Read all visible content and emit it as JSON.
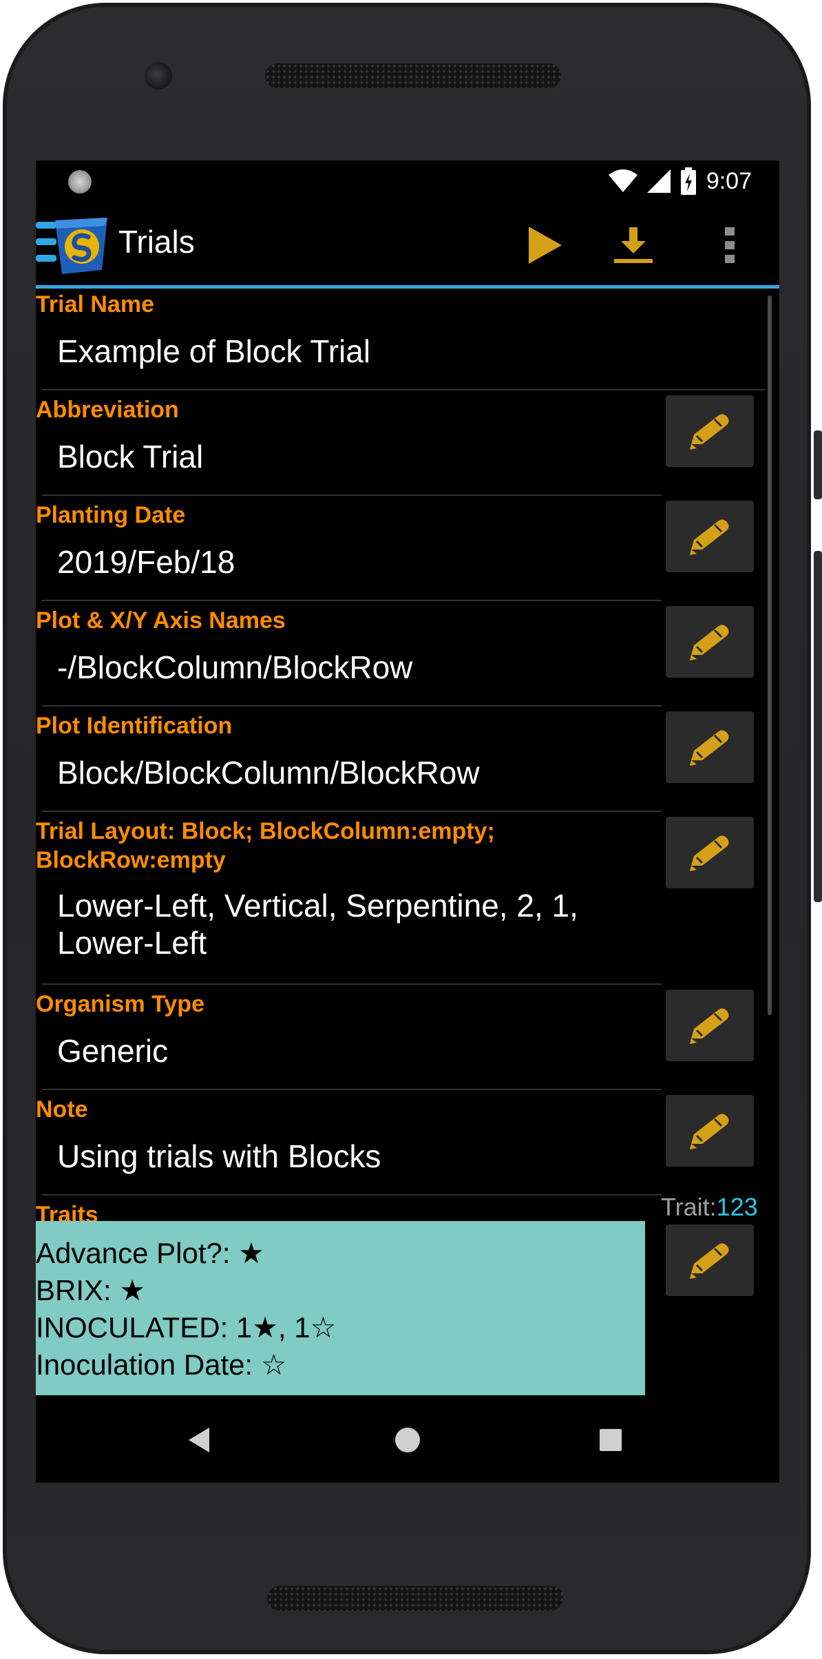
{
  "statusbar": {
    "time": "9:07"
  },
  "appbar": {
    "title": "Trials"
  },
  "fields": [
    {
      "label": "Trial Name",
      "value": "Example of Block Trial"
    },
    {
      "label": "Abbreviation",
      "value": "Block Trial"
    },
    {
      "label": "Planting Date",
      "value": "2019/Feb/18"
    },
    {
      "label": "Plot & X/Y Axis Names",
      "value": "-/BlockColumn/BlockRow"
    },
    {
      "label": "Plot Identification",
      "value": "Block/BlockColumn/BlockRow"
    },
    {
      "label_line1": "Trial Layout: Block; BlockColumn:empty;",
      "label_line2": "BlockRow:empty",
      "value_line1": "Lower-Left, Vertical, Serpentine, 2, 1,",
      "value_line2": "Lower-Left"
    },
    {
      "label": "Organism Type",
      "value": "Generic"
    },
    {
      "label": "Note",
      "value": "Using trials with Blocks"
    }
  ],
  "traits": {
    "label": "Traits",
    "count_label": "Trait:",
    "count_value": "123",
    "items": [
      "Advance Plot?: ★",
      "BRIX: ★",
      "INOCULATED: 1★, 1☆",
      "Inoculation Date: ☆"
    ]
  },
  "icons": {
    "edit": "pencil-icon",
    "play": "play-icon",
    "download": "download-icon",
    "more": "more-vert-icon"
  },
  "colors": {
    "accent": "#ff8c00",
    "icon": "#d4a017",
    "divider": "#3aa6e0",
    "traits_bg": "#80cbc4",
    "count": "#2bc6e8"
  }
}
